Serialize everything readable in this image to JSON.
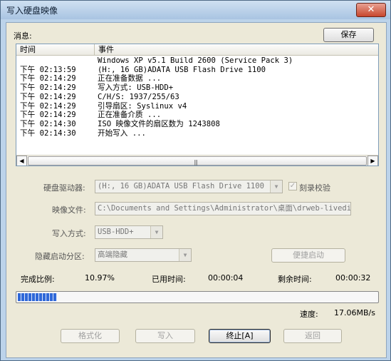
{
  "window": {
    "title": "写入硬盘映像",
    "close_glyph": "✕"
  },
  "messages": {
    "label": "消息:",
    "save_button": "保存",
    "columns": [
      "时间",
      "事件"
    ],
    "rows": [
      {
        "time": "",
        "event": "Windows XP v5.1 Build 2600 (Service Pack 3)"
      },
      {
        "time": "下午 02:13:59",
        "event": "(H:, 16 GB)ADATA   USB Flash Drive 1100"
      },
      {
        "time": "下午 02:14:29",
        "event": "正在准备数据 ..."
      },
      {
        "time": "下午 02:14:29",
        "event": "写入方式: USB-HDD+"
      },
      {
        "time": "下午 02:14:29",
        "event": "C/H/S: 1937/255/63"
      },
      {
        "time": "下午 02:14:29",
        "event": "引导扇区: Syslinux v4"
      },
      {
        "time": "下午 02:14:29",
        "event": "正在准备介质 ..."
      },
      {
        "time": "下午 02:14:30",
        "event": "ISO 映像文件的扇区数为 1243808"
      },
      {
        "time": "下午 02:14:30",
        "event": "开始写入 ..."
      }
    ],
    "scroll_left": "◀",
    "scroll_right": "▶",
    "scroll_grip": "|||"
  },
  "form": {
    "drive_label": "硬盘驱动器:",
    "drive_value": "(H:, 16 GB)ADATA   USB Flash Drive 1100",
    "verify_label": "刻录校验",
    "verify_checked": true,
    "check_glyph": "✓",
    "image_label": "映像文件:",
    "image_value": "C:\\Documents and Settings\\Administrator\\桌面\\drweb-livedisk",
    "write_mode_label": "写入方式:",
    "write_mode_value": "USB-HDD+",
    "hidden_label": "隐藏启动分区:",
    "hidden_value": "高端隐藏",
    "quick_boot_button": "便捷启动",
    "dropdown_glyph": "▼"
  },
  "status": {
    "percent_label": "完成比例:",
    "percent_value": "10.97%",
    "progress_fraction": 0.1097,
    "elapsed_label": "已用时间:",
    "elapsed_value": "00:00:04",
    "remaining_label": "剩余时间:",
    "remaining_value": "00:00:32",
    "speed_label": "速度:",
    "speed_value": "17.06MB/s"
  },
  "buttons": {
    "format": "格式化",
    "write": "写入",
    "stop": "终止[A]",
    "back": "返回"
  }
}
